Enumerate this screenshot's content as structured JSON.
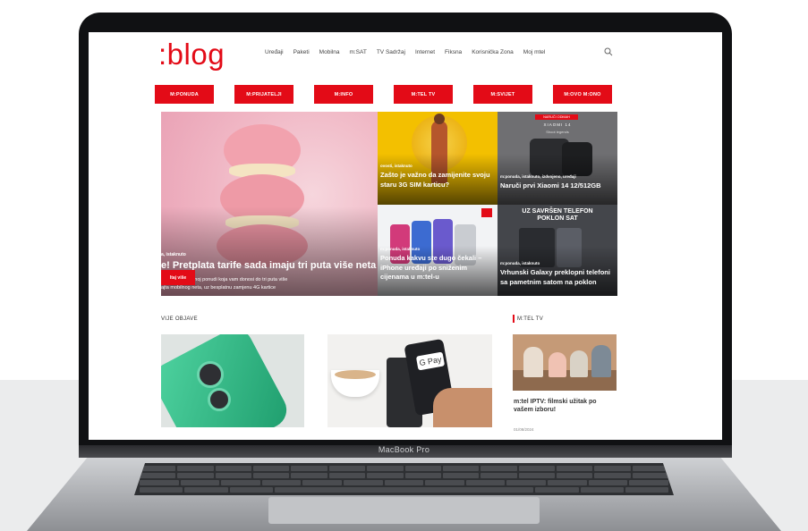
{
  "site": {
    "logo": ":blog",
    "nav": [
      "Uređaji",
      "Paketi",
      "Mobilna",
      "m:SAT",
      "TV Sadržaj",
      "Internet",
      "Fiksna",
      "Korisnička Zona",
      "Moj mtel"
    ],
    "search_icon": "search-icon",
    "categories": [
      "M:PONUDA",
      "M:PRIJATELJI",
      "M:INFO",
      "M:TEL TV",
      "M:SVIJET",
      "M:OVO M:ONO"
    ],
    "accent": "#e30b17"
  },
  "hero": {
    "category": "a, istaknuto",
    "title": "e! Pretplata tarife sada imaju tri puta više neta",
    "excerpt_line1": "jte u nevjerovatnoj ponudi koja vam donosi do tri puta više",
    "excerpt_line2": "ajta mobilnog neta, uz besplatnu zamjenu 4G kartice",
    "button": "ltaj više"
  },
  "cards": [
    {
      "category": "ovosti, istaknuto",
      "title": "Zašto je važno da zamijenite svoju staru 3G SIM karticu?"
    },
    {
      "category": "m:ponuda, istaknuto, izdvojeno, uređaji",
      "title": "Naruči prvi Xiaomi 14 12/512GB",
      "badge": "NARUČI ODMAH",
      "brand": "XIAOMI 14",
      "subtitle": "Shoot legends"
    },
    {
      "category": "m:ponuda, istaknuto",
      "title": "Ponuda kakvu ste dugo čekali – iPhone uređaji po sniženim cijenama u m:tel-u"
    },
    {
      "category": "m:ponuda, istaknuto",
      "title": "Vrhunski Galaxy preklopni telefoni sa pametnim satom na poklon",
      "overlay": "UZ SAVRŠEN TELEFON POKLON SAT"
    }
  ],
  "sections": {
    "left_title": "VIJE OBJAVE",
    "right_title": "M:TEL TV"
  },
  "sidebar_post": {
    "title": "m:tel IPTV: filmski užitak po vašem izboru!",
    "date": "01/08/2024"
  },
  "device": {
    "label": "MacBook Pro"
  }
}
